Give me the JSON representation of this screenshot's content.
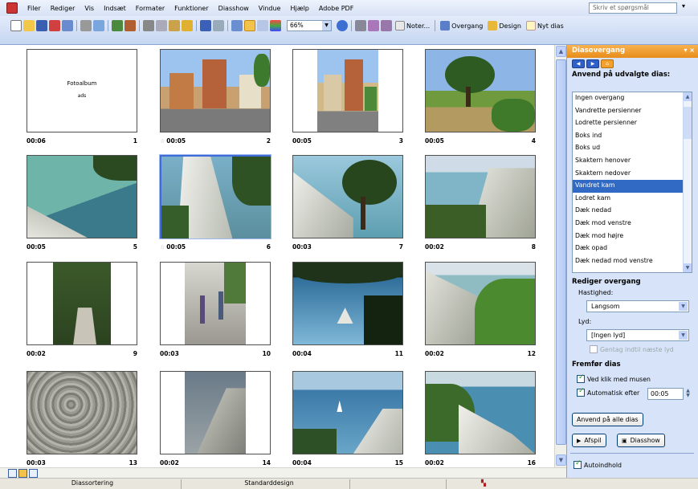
{
  "menu": [
    "Filer",
    "Rediger",
    "Vis",
    "Indsæt",
    "Formater",
    "Funktioner",
    "Diasshow",
    "Vindue",
    "Hjælp",
    "Adobe PDF"
  ],
  "help_placeholder": "Skriv et spørgsmål",
  "toolbar": {
    "zoom": "66%",
    "notes": "Noter...",
    "transition": "Overgang",
    "design": "Design",
    "new_slide": "Nyt dias"
  },
  "slides": [
    {
      "time": "00:06",
      "num": "1",
      "title": "Fotoalbum",
      "subtitle": "ads",
      "photo": "none"
    },
    {
      "time": "00:05",
      "num": "2",
      "photo": "street",
      "star": true
    },
    {
      "time": "00:05",
      "num": "3",
      "photo": "street-narrow"
    },
    {
      "time": "00:05",
      "num": "4",
      "photo": "tree-field"
    },
    {
      "time": "00:05",
      "num": "5",
      "photo": "cliff-sea"
    },
    {
      "time": "00:05",
      "num": "6",
      "photo": "white-cliff",
      "star": true,
      "selected": true
    },
    {
      "time": "00:03",
      "num": "7",
      "photo": "cliff-tree"
    },
    {
      "time": "00:02",
      "num": "8",
      "photo": "cliff-coast"
    },
    {
      "time": "00:02",
      "num": "9",
      "photo": "stairs-narrow"
    },
    {
      "time": "00:03",
      "num": "10",
      "photo": "hikers-narrow"
    },
    {
      "time": "00:04",
      "num": "11",
      "photo": "sea-view"
    },
    {
      "time": "00:02",
      "num": "12",
      "photo": "cliff-green"
    },
    {
      "time": "00:03",
      "num": "13",
      "photo": "rocks"
    },
    {
      "time": "00:02",
      "num": "14",
      "photo": "rock-narrow"
    },
    {
      "time": "00:04",
      "num": "15",
      "photo": "sea-boat"
    },
    {
      "time": "00:02",
      "num": "16",
      "photo": "cliff-sea2"
    }
  ],
  "taskpane": {
    "title": "Diasovergang",
    "apply_heading": "Anvend på udvalgte dias:",
    "transitions": [
      "Ingen overgang",
      "Vandrette persienner",
      "Lodrette persienner",
      "Boks ind",
      "Boks ud",
      "Skaktern henover",
      "Skaktern nedover",
      "Vandret kam",
      "Lodret kam",
      "Dæk nedad",
      "Dæk mod venstre",
      "Dæk mod højre",
      "Dæk opad",
      "Dæk nedad mod venstre"
    ],
    "selected_transition": "Vandret kam",
    "edit_heading": "Rediger overgang",
    "speed_label": "Hastighed:",
    "speed_value": "Langsom",
    "sound_label": "Lyd:",
    "sound_value": "[Ingen lyd]",
    "loop_label": "Gentag indtil næste lyd",
    "advance_heading": "Fremfør dias",
    "on_click_label": "Ved klik med musen",
    "auto_label": "Automatisk efter",
    "auto_value": "00:05",
    "apply_all": "Anvend på alle dias",
    "play": "Afspil",
    "slideshow": "Diasshow",
    "autopreview": "Autoindhold"
  },
  "status": {
    "view": "Diassortering",
    "design": "Standarddesign"
  }
}
